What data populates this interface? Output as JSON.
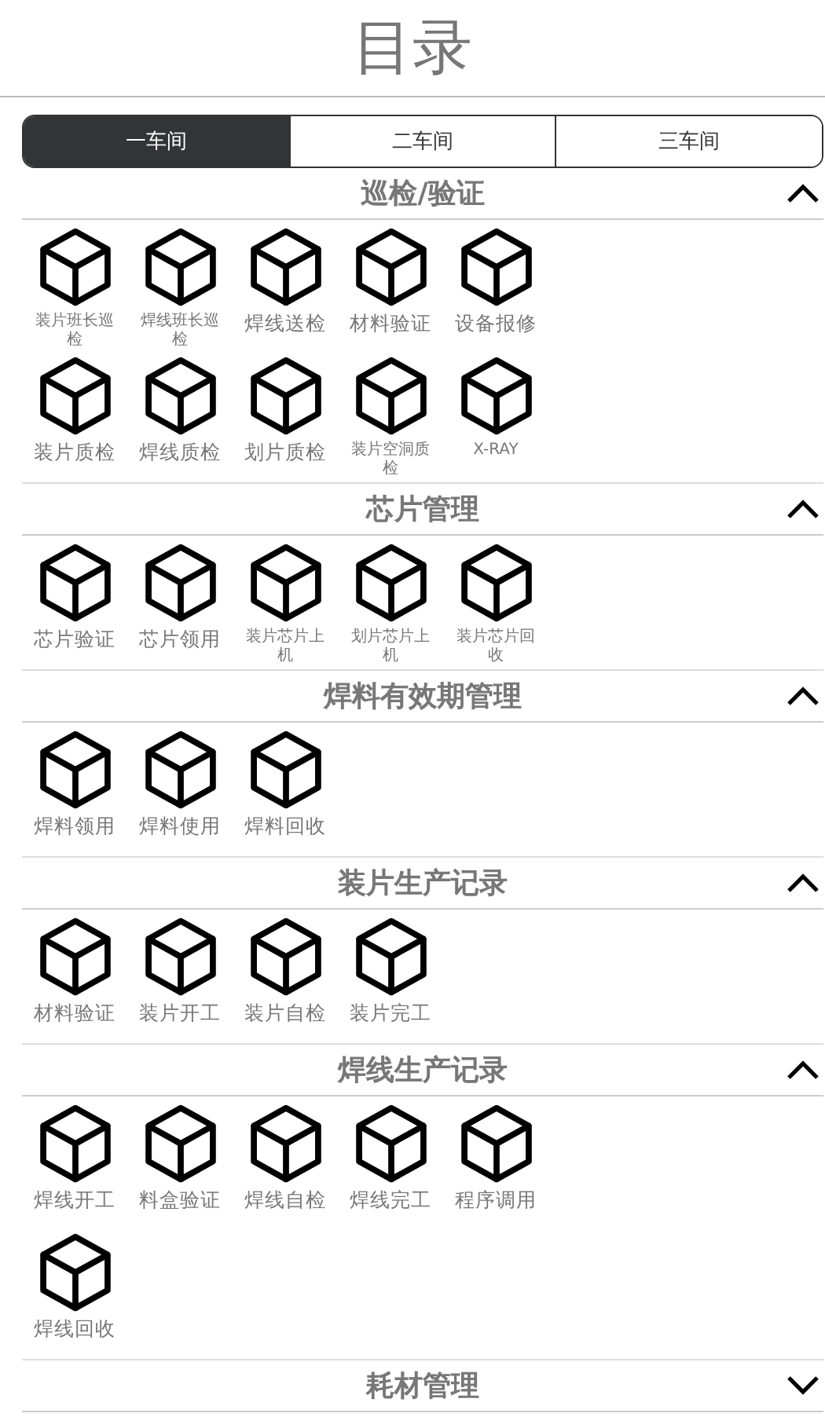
{
  "title": "目录",
  "tabs": [
    {
      "label": "一车间",
      "selected": true
    },
    {
      "label": "二车间",
      "selected": false
    },
    {
      "label": "三车间",
      "selected": false
    }
  ],
  "sections": [
    {
      "title": "巡检/验证",
      "expanded": true,
      "items": [
        "装片班长巡检",
        "焊线班长巡检",
        "焊线送检",
        "材料验证",
        "设备报修",
        "装片质检",
        "焊线质检",
        "划片质检",
        "装片空洞质检",
        "X-RAY"
      ]
    },
    {
      "title": "芯片管理",
      "expanded": true,
      "items": [
        "芯片验证",
        "芯片领用",
        "装片芯片上机",
        "划片芯片上机",
        "装片芯片回收"
      ]
    },
    {
      "title": "焊料有效期管理",
      "expanded": true,
      "items": [
        "焊料领用",
        "焊料使用",
        "焊料回收"
      ]
    },
    {
      "title": "装片生产记录",
      "expanded": true,
      "items": [
        "材料验证",
        "装片开工",
        "装片自检",
        "装片完工"
      ]
    },
    {
      "title": "焊线生产记录",
      "expanded": true,
      "items": [
        "焊线开工",
        "料盒验证",
        "焊线自检",
        "焊线完工",
        "程序调用",
        "焊线回收"
      ]
    },
    {
      "title": "耗材管理",
      "expanded": false
    }
  ]
}
